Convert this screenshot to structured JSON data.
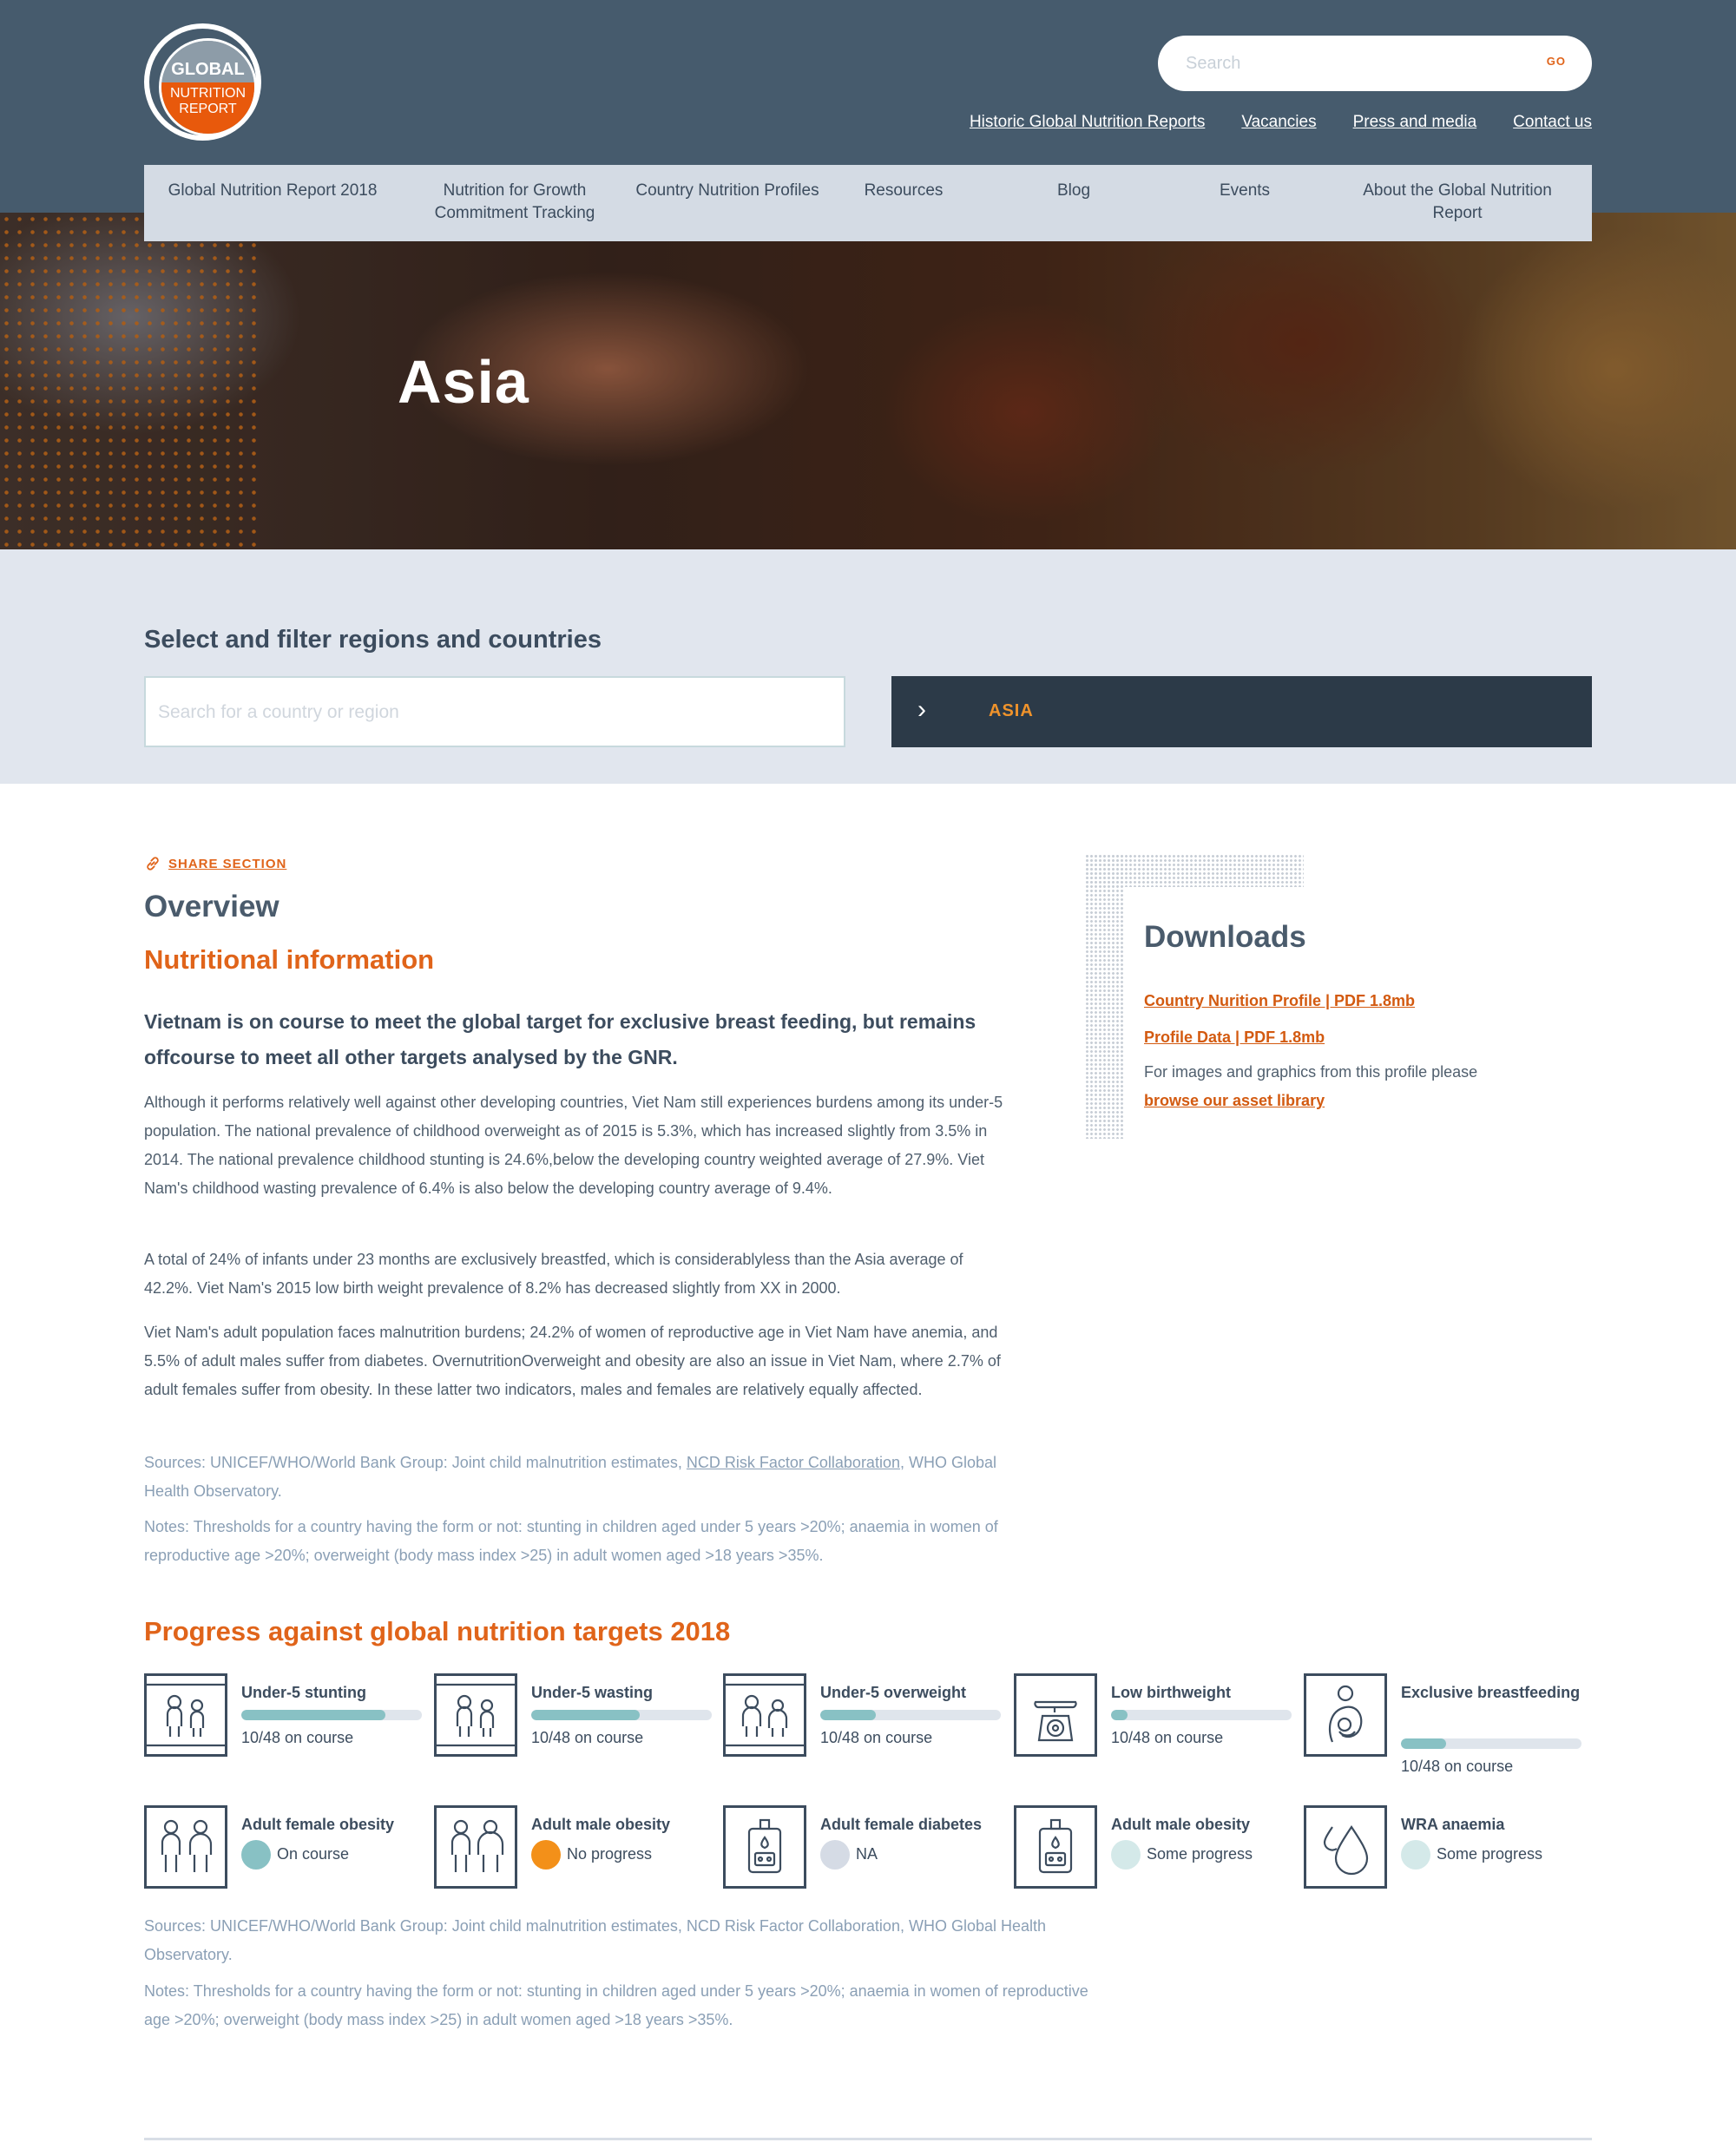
{
  "logo": {
    "line1": "GLOBAL",
    "line2": "NUTRITION",
    "line3": "REPORT"
  },
  "search": {
    "placeholder": "Search",
    "go_label": "GO"
  },
  "top_links": [
    "Historic Global Nutrition Reports",
    "Vacancies",
    "Press and media",
    "Contact us"
  ],
  "nav": [
    "Global Nutrition Report 2018",
    "Nutrition for Growth Commitment Tracking",
    "Country Nutrition Profiles",
    "Resources",
    "Blog",
    "Events",
    "About the Global Nutrition Report"
  ],
  "hero": {
    "title": "Asia"
  },
  "filter": {
    "heading": "Select and filter regions and countries",
    "input_placeholder": "Search for a country or region",
    "chevron": "›",
    "selected": "ASIA"
  },
  "overview": {
    "share_label": "SHARE SECTION",
    "title": "Overview",
    "subtitle": "Nutritional information",
    "lead": "Vietnam is on course to meet the global target for exclusive breast feeding, but remains offcourse to meet all other targets analysed by the GNR.",
    "paragraphs": [
      "Although it performs relatively well against other developing countries, Viet Nam still experiences burdens among its under-5 population. The national prevalence of childhood overweight as of 2015 is 5.3%, which has increased slightly from 3.5% in 2014. The national prevalence childhood stunting is 24.6%,below the developing country weighted average of 27.9%. Viet Nam's childhood wasting prevalence of 6.4% is also below the developing country average of 9.4%.",
      "A total of 24% of infants under 23 months are exclusively breastfed, which is considerablyless than the Asia average of 42.2%. Viet Nam's 2015 low birth weight prevalence of 8.2% has decreased slightly from XX in 2000.",
      "Viet Nam's adult population faces malnutrition burdens; 24.2% of women of reproductive age in Viet Nam have anemia, and 5.5% of adult males suffer from diabetes. OvernutritionOverweight and obesity are also an issue in Viet Nam, where 2.7% of adult females suffer from obesity. In these latter two indicators, males and females are relatively equally affected."
    ],
    "sources_prefix": "Sources: UNICEF/WHO/World Bank Group: Joint child malnutrition estimates, ",
    "sources_link": "NCD Risk Factor Collaboration",
    "sources_suffix": ", WHO Global Health Observatory.",
    "notes": "Notes: Thresholds for a country having the form or not: stunting in children aged under 5 years >20%; anaemia in women of reproductive age >20%; overweight (body mass index >25) in adult women aged >18 years >35%."
  },
  "downloads": {
    "title": "Downloads",
    "link1": "Country Nurition Profile | PDF 1.8mb",
    "link2": "Profile Data | PDF 1.8mb",
    "note": "For images and graphics from this profile please",
    "note_link": "browse our asset library"
  },
  "progress": {
    "title": "Progress against global nutrition targets 2018",
    "bar_cards": [
      {
        "title": "Under-5 stunting",
        "status": "10/48 on course",
        "fill": 0.8,
        "icon": "children-icon"
      },
      {
        "title": "Under-5 wasting",
        "status": "10/48 on course",
        "fill": 0.6,
        "icon": "children-icon"
      },
      {
        "title": "Under-5 overweight",
        "status": "10/48 on course",
        "fill": 0.31,
        "icon": "children-icon"
      },
      {
        "title": "Low birthweight",
        "status": "10/48 on course",
        "fill": 0.09,
        "icon": "baby-scale-icon"
      },
      {
        "title": "Exclusive breastfeeding",
        "status": "10/48 on course",
        "fill": 0.25,
        "icon": "breastfeeding-icon"
      }
    ],
    "dot_cards": [
      {
        "title": "Adult female obesity",
        "status": "On course",
        "color": "#88c1c4",
        "icon": "adults-icon"
      },
      {
        "title": "Adult male obesity",
        "status": "No progress",
        "color": "#f39019",
        "icon": "adults-icon"
      },
      {
        "title": "Adult female diabetes",
        "status": "NA",
        "color": "#d5dbe5",
        "icon": "glucose-meter-icon"
      },
      {
        "title": "Adult male obesity",
        "status": "Some progress",
        "color": "#d4e9e9",
        "icon": "glucose-meter-icon"
      },
      {
        "title": "WRA anaemia",
        "status": "Some progress",
        "color": "#d4e9e9",
        "icon": "blood-drop-icon"
      }
    ],
    "sources": "Sources: UNICEF/WHO/World Bank Group: Joint child malnutrition estimates, NCD Risk Factor Collaboration, WHO Global Health Observatory.",
    "notes": "Notes: Thresholds for a country having the form or not: stunting in children aged under 5 years >20%; anaemia in women of reproductive age >20%; overweight (body mass index >25) in adult women aged >18 years >35%."
  },
  "colors": {
    "header": "#465b6d",
    "accent": "#e0641a",
    "nav": "#d4dbe4",
    "filter_band": "#e1e6ee",
    "selected_bg": "#2c3a48"
  }
}
